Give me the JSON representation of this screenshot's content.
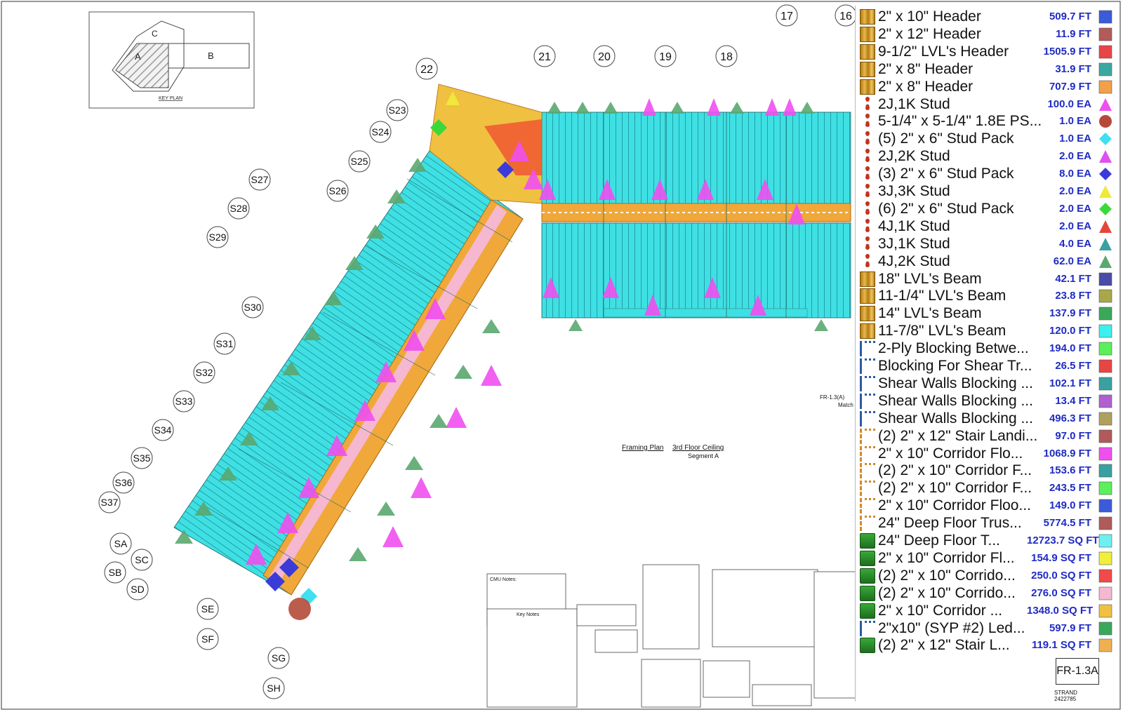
{
  "plan": {
    "title": "Framing Plan",
    "level": "3rd Floor Ceiling",
    "segment": "Segment A",
    "sheet": "FR-1.3A",
    "sheet_match": "FR-1.3(A)",
    "match_label": "Match",
    "project_code": "STRAND",
    "project_number": "2422785",
    "key_plan_label": "KEY PLAN",
    "key_plan_zones": [
      "A",
      "B",
      "C"
    ],
    "grid_top": [
      "22",
      "21",
      "20",
      "19",
      "18",
      "17",
      "16"
    ],
    "grid_left": [
      "S23",
      "S24",
      "S25",
      "S26",
      "S27",
      "S28",
      "S29",
      "S30",
      "S31",
      "S32",
      "S33",
      "S34",
      "S35",
      "S36",
      "S37",
      "SA",
      "SB",
      "SC",
      "SD",
      "SE",
      "SF",
      "SG",
      "SH"
    ],
    "notes_title": "Key Notes",
    "cmu_notes": "CMU Notes:"
  },
  "legend": {
    "items": [
      {
        "name": "2\" x 10\" Header",
        "qty": "509.7 FT",
        "icon": "beam-icon",
        "swatch": "square",
        "color": "#3b5bd9"
      },
      {
        "name": "2\" x 12\" Header",
        "qty": "11.9 FT",
        "icon": "beam-icon",
        "swatch": "square",
        "color": "#b35a5a"
      },
      {
        "name": "9-1/2\" LVL's Header",
        "qty": "1505.9 FT",
        "icon": "beam-icon",
        "swatch": "square",
        "color": "#e84545"
      },
      {
        "name": "2\" x 8\" Header",
        "qty": "31.9 FT",
        "icon": "beam-icon",
        "swatch": "square",
        "color": "#3aa8a0"
      },
      {
        "name": "2\" x 8\" Header",
        "qty": "707.9 FT",
        "icon": "beam-icon",
        "swatch": "square",
        "color": "#f2a04a"
      },
      {
        "name": "2J,1K Stud",
        "qty": "100.0 EA",
        "icon": "stud-icon",
        "swatch": "triangle",
        "color": "#f04ff0"
      },
      {
        "name": "5-1/4\" x 5-1/4\" 1.8E PS...",
        "qty": "1.0 EA",
        "icon": "stud-icon",
        "swatch": "circle",
        "color": "#b54a3a"
      },
      {
        "name": "(5) 2\" x 6\" Stud Pack",
        "qty": "1.0 EA",
        "icon": "stud-icon",
        "swatch": "diamond",
        "color": "#3fe0f0"
      },
      {
        "name": "2J,2K Stud",
        "qty": "2.0 EA",
        "icon": "stud-icon",
        "swatch": "triangle",
        "color": "#e04ff0"
      },
      {
        "name": "(3) 2\" x 6\" Stud Pack",
        "qty": "8.0 EA",
        "icon": "stud-icon",
        "swatch": "diamond",
        "color": "#3b3bd9"
      },
      {
        "name": "3J,3K Stud",
        "qty": "2.0 EA",
        "icon": "stud-icon",
        "swatch": "triangle",
        "color": "#f0e83a"
      },
      {
        "name": "(6) 2\" x 6\" Stud Pack",
        "qty": "2.0 EA",
        "icon": "stud-icon",
        "swatch": "diamond",
        "color": "#3ad93a"
      },
      {
        "name": "4J,1K Stud",
        "qty": "2.0 EA",
        "icon": "stud-icon",
        "swatch": "triangle",
        "color": "#e8453a"
      },
      {
        "name": "3J,1K Stud",
        "qty": "4.0 EA",
        "icon": "stud-icon",
        "swatch": "triangle",
        "color": "#3aa0a0"
      },
      {
        "name": "4J,2K Stud",
        "qty": "62.0 EA",
        "icon": "stud-icon",
        "swatch": "triangle",
        "color": "#5aa870"
      },
      {
        "name": "18\" LVL's Beam",
        "qty": "42.1 FT",
        "icon": "beam-icon",
        "swatch": "square",
        "color": "#4a4aa8"
      },
      {
        "name": "11-1/4\" LVL's Beam",
        "qty": "23.8 FT",
        "icon": "beam-icon",
        "swatch": "square",
        "color": "#a8a84a"
      },
      {
        "name": "14\" LVL's Beam",
        "qty": "137.9 FT",
        "icon": "beam-icon",
        "swatch": "square",
        "color": "#3aa85a"
      },
      {
        "name": "11-7/8\" LVL's Beam",
        "qty": "120.0 FT",
        "icon": "beam-icon",
        "swatch": "square",
        "color": "#3af0f0"
      },
      {
        "name": "2-Ply Blocking Betwe...",
        "qty": "194.0 FT",
        "icon": "block-icon",
        "swatch": "square",
        "color": "#5af05a"
      },
      {
        "name": "Blocking For Shear Tr...",
        "qty": "26.5 FT",
        "icon": "block-icon",
        "swatch": "square",
        "color": "#e84545"
      },
      {
        "name": "Shear Walls Blocking ...",
        "qty": "102.1 FT",
        "icon": "block-icon",
        "swatch": "square",
        "color": "#3aa0a0"
      },
      {
        "name": "Shear Walls Blocking ...",
        "qty": "13.4 FT",
        "icon": "block-icon",
        "swatch": "square",
        "color": "#b060d0"
      },
      {
        "name": "Shear Walls Blocking ...",
        "qty": "496.3 FT",
        "icon": "block-icon",
        "swatch": "square",
        "color": "#b0a060"
      },
      {
        "name": "(2) 2\" x 12\" Stair Landi...",
        "qty": "97.0 FT",
        "icon": "rail-icon",
        "swatch": "square",
        "color": "#b05a5a"
      },
      {
        "name": "2\" x 10\" Corridor Flo...",
        "qty": "1068.9 FT",
        "icon": "rail-icon",
        "swatch": "square",
        "color": "#f04ff0"
      },
      {
        "name": "(2) 2\" x 10\" Corridor F...",
        "qty": "153.6 FT",
        "icon": "rail-icon",
        "swatch": "square",
        "color": "#3aa0a0"
      },
      {
        "name": "(2) 2\" x 10\" Corridor F...",
        "qty": "243.5 FT",
        "icon": "rail-icon",
        "swatch": "square",
        "color": "#5af05a"
      },
      {
        "name": "2\" x 10\" Corridor Floo...",
        "qty": "149.0 FT",
        "icon": "rail-icon",
        "swatch": "square",
        "color": "#3b5bd9"
      },
      {
        "name": "24\" Deep Floor Trus...",
        "qty": "5774.5 FT",
        "icon": "rail-icon",
        "swatch": "square",
        "color": "#b05a5a"
      },
      {
        "name": "24\" Deep Floor T...",
        "qty": "12723.7 SQ FT",
        "icon": "floor-icon",
        "swatch": "square",
        "color": "#6ff0f0"
      },
      {
        "name": "2\" x 10\" Corridor Fl...",
        "qty": "154.9 SQ FT",
        "icon": "floor-icon",
        "swatch": "square",
        "color": "#f0f03a"
      },
      {
        "name": "(2) 2\" x 10\" Corrido...",
        "qty": "250.0 SQ FT",
        "icon": "floor-icon",
        "swatch": "square",
        "color": "#f04a4a"
      },
      {
        "name": "(2) 2\" x 10\" Corrido...",
        "qty": "276.0 SQ FT",
        "icon": "floor-icon",
        "swatch": "square",
        "color": "#f5b8d0"
      },
      {
        "name": "2\" x 10\" Corridor ...",
        "qty": "1348.0 SQ FT",
        "icon": "floor-icon",
        "swatch": "square",
        "color": "#f0c040"
      },
      {
        "name": "2\"x10\" (SYP #2) Led...",
        "qty": "597.9 FT",
        "icon": "block-icon",
        "swatch": "square",
        "color": "#3aa85a"
      },
      {
        "name": "(2) 2\" x 12\" Stair L...",
        "qty": "119.1 SQ FT",
        "icon": "floor-icon",
        "swatch": "square",
        "color": "#f0b050"
      }
    ]
  }
}
